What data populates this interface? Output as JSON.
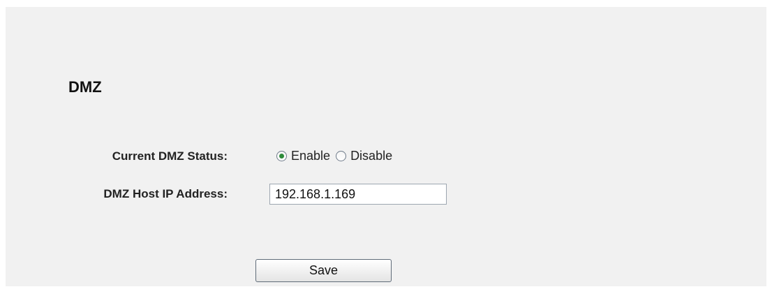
{
  "page": {
    "title": "DMZ"
  },
  "form": {
    "status_label": "Current DMZ Status:",
    "status_options": [
      {
        "label": "Enable",
        "selected": true
      },
      {
        "label": "Disable",
        "selected": false
      }
    ],
    "ip_label": "DMZ Host IP Address:",
    "ip_value": "192.168.1.169",
    "save_label": "Save"
  },
  "colors": {
    "panel_background": "#f1f1f1",
    "radio_selected_dot": "#2e8b3a"
  }
}
